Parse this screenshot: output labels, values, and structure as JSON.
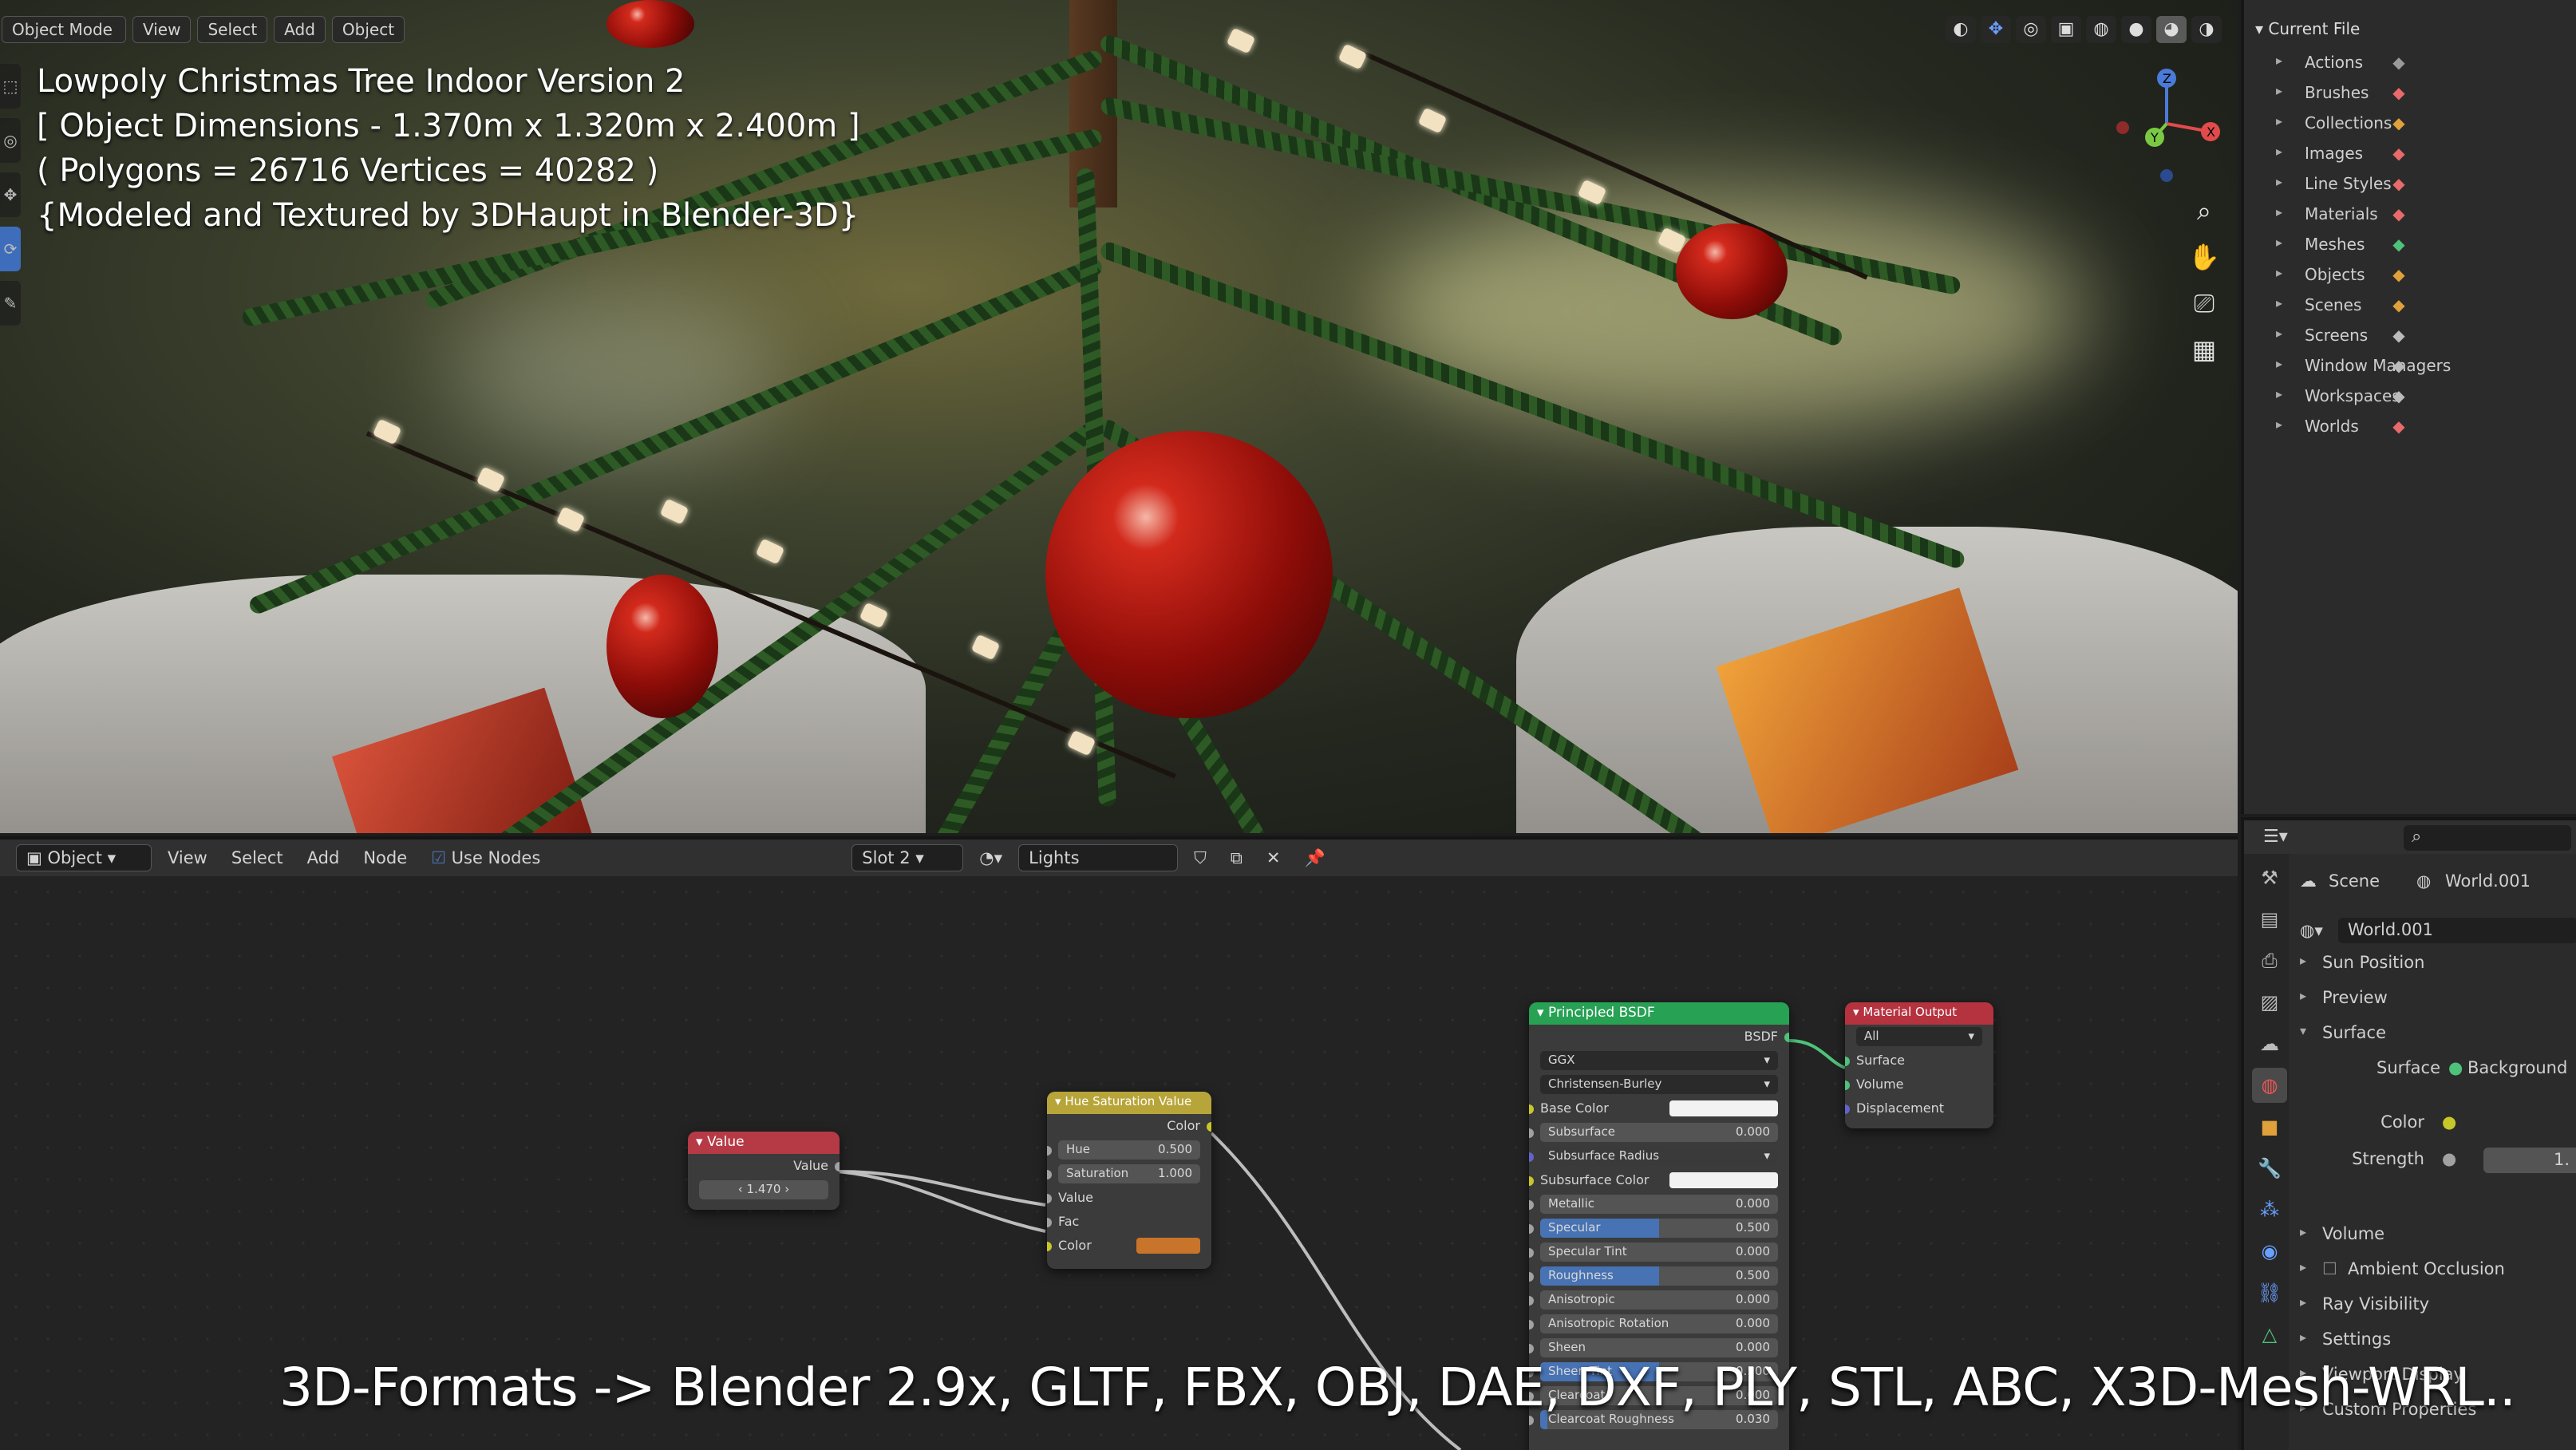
{
  "viewport": {
    "header": [
      "Object Mode",
      "View",
      "Select",
      "Add",
      "Object"
    ],
    "overlay_lines": [
      "Lowpoly Christmas Tree Indoor Version 2",
      "[ Object Dimensions -  1.370m x 1.320m x 2.400m ]",
      "( Polygons = 26716  Vertices = 40282 )",
      "{Modeled and Textured by 3DHaupt in Blender-3D}"
    ],
    "gizmo": {
      "z": "Z",
      "y": "Y",
      "x": "X"
    }
  },
  "outliner": {
    "root": "Current File",
    "items": [
      {
        "label": "Actions",
        "icon": "action-icon",
        "color": "#9a9a9a"
      },
      {
        "label": "Brushes",
        "icon": "brush-icon",
        "color": "#e86a6a"
      },
      {
        "label": "Collections",
        "icon": "collection-icon",
        "color": "#e0a03a"
      },
      {
        "label": "Images",
        "icon": "image-icon",
        "color": "#e86a6a"
      },
      {
        "label": "Line Styles",
        "icon": "linestyle-icon",
        "color": "#e86a6a"
      },
      {
        "label": "Materials",
        "icon": "material-icon",
        "color": "#e86a6a"
      },
      {
        "label": "Meshes",
        "icon": "mesh-icon",
        "color": "#4ec27a"
      },
      {
        "label": "Objects",
        "icon": "object-icon",
        "color": "#e0a03a"
      },
      {
        "label": "Scenes",
        "icon": "scene-icon",
        "color": "#e0a03a"
      },
      {
        "label": "Screens",
        "icon": "screen-icon",
        "color": "#bbbbbb"
      },
      {
        "label": "Window Managers",
        "icon": "window-icon",
        "color": "#bbbbbb"
      },
      {
        "label": "Workspaces",
        "icon": "workspace-icon",
        "color": "#bbbbbb"
      },
      {
        "label": "Worlds",
        "icon": "world-icon",
        "color": "#e86a6a"
      }
    ]
  },
  "node_header": {
    "object": "Object",
    "menu": [
      "View",
      "Select",
      "Add",
      "Node"
    ],
    "use_nodes": "Use Nodes",
    "slot": "Slot 2",
    "material": "Lights"
  },
  "nodes": {
    "value": {
      "title": "Value",
      "out": "Value",
      "val": "1.470"
    },
    "hsv": {
      "title": "Hue Saturation Value",
      "out": "Color",
      "hue_label": "Hue",
      "hue": "0.500",
      "sat_label": "Saturation",
      "sat": "1.000",
      "in_value": "Value",
      "in_fac": "Fac",
      "in_color": "Color",
      "color_swatch": "#c8742a"
    },
    "bsdf": {
      "title": "Principled BSDF",
      "out": "BSDF",
      "dist": "GGX",
      "sss": "Christensen-Burley",
      "rows": [
        {
          "label": "Base Color",
          "value": "",
          "kind": "color",
          "fill": 0
        },
        {
          "label": "Subsurface",
          "value": "0.000",
          "kind": "num",
          "fill": 0
        },
        {
          "label": "Subsurface Radius",
          "value": "",
          "kind": "drop",
          "fill": 0
        },
        {
          "label": "Subsurface Color",
          "value": "",
          "kind": "color",
          "fill": 0
        },
        {
          "label": "Metallic",
          "value": "0.000",
          "kind": "num",
          "fill": 0
        },
        {
          "label": "Specular",
          "value": "0.500",
          "kind": "num",
          "fill": 0.5
        },
        {
          "label": "Specular Tint",
          "value": "0.000",
          "kind": "num",
          "fill": 0
        },
        {
          "label": "Roughness",
          "value": "0.500",
          "kind": "num",
          "fill": 0.5
        },
        {
          "label": "Anisotropic",
          "value": "0.000",
          "kind": "num",
          "fill": 0
        },
        {
          "label": "Anisotropic Rotation",
          "value": "0.000",
          "kind": "num",
          "fill": 0
        },
        {
          "label": "Sheen",
          "value": "0.000",
          "kind": "num",
          "fill": 0
        },
        {
          "label": "Sheen Tint",
          "value": "0.500",
          "kind": "num",
          "fill": 0.5
        },
        {
          "label": "Clearcoat",
          "value": "0.000",
          "kind": "num",
          "fill": 0
        },
        {
          "label": "Clearcoat Roughness",
          "value": "0.030",
          "kind": "num",
          "fill": 0.03
        }
      ]
    },
    "output": {
      "title": "Material Output",
      "target": "All",
      "surface": "Surface",
      "volume": "Volume",
      "displacement": "Displacement"
    }
  },
  "properties": {
    "scene": "Scene",
    "world": "World.001",
    "world_field": "World.001",
    "panels_top": [
      "Sun Position",
      "Preview",
      "Surface"
    ],
    "surface_label": "Surface",
    "surface_value": "Background",
    "color_label": "Color",
    "strength_label": "Strength",
    "strength_value": "1.",
    "panels_bottom": [
      "Volume",
      "Ambient Occlusion",
      "Ray Visibility",
      "Settings",
      "Viewport Display",
      "Custom Properties"
    ]
  },
  "caption": "3D-Formats -> Blender 2.9x, GLTF, FBX, OBJ, DAE, DXF, PLY, STL, ABC, X3D-Mesh-WRL..",
  "colors": {
    "value_node": "#b53a45",
    "hsv_node": "#b8a53a",
    "bsdf_node": "#27a154",
    "output_node": "#b5323f",
    "accent": "#4772b3"
  }
}
